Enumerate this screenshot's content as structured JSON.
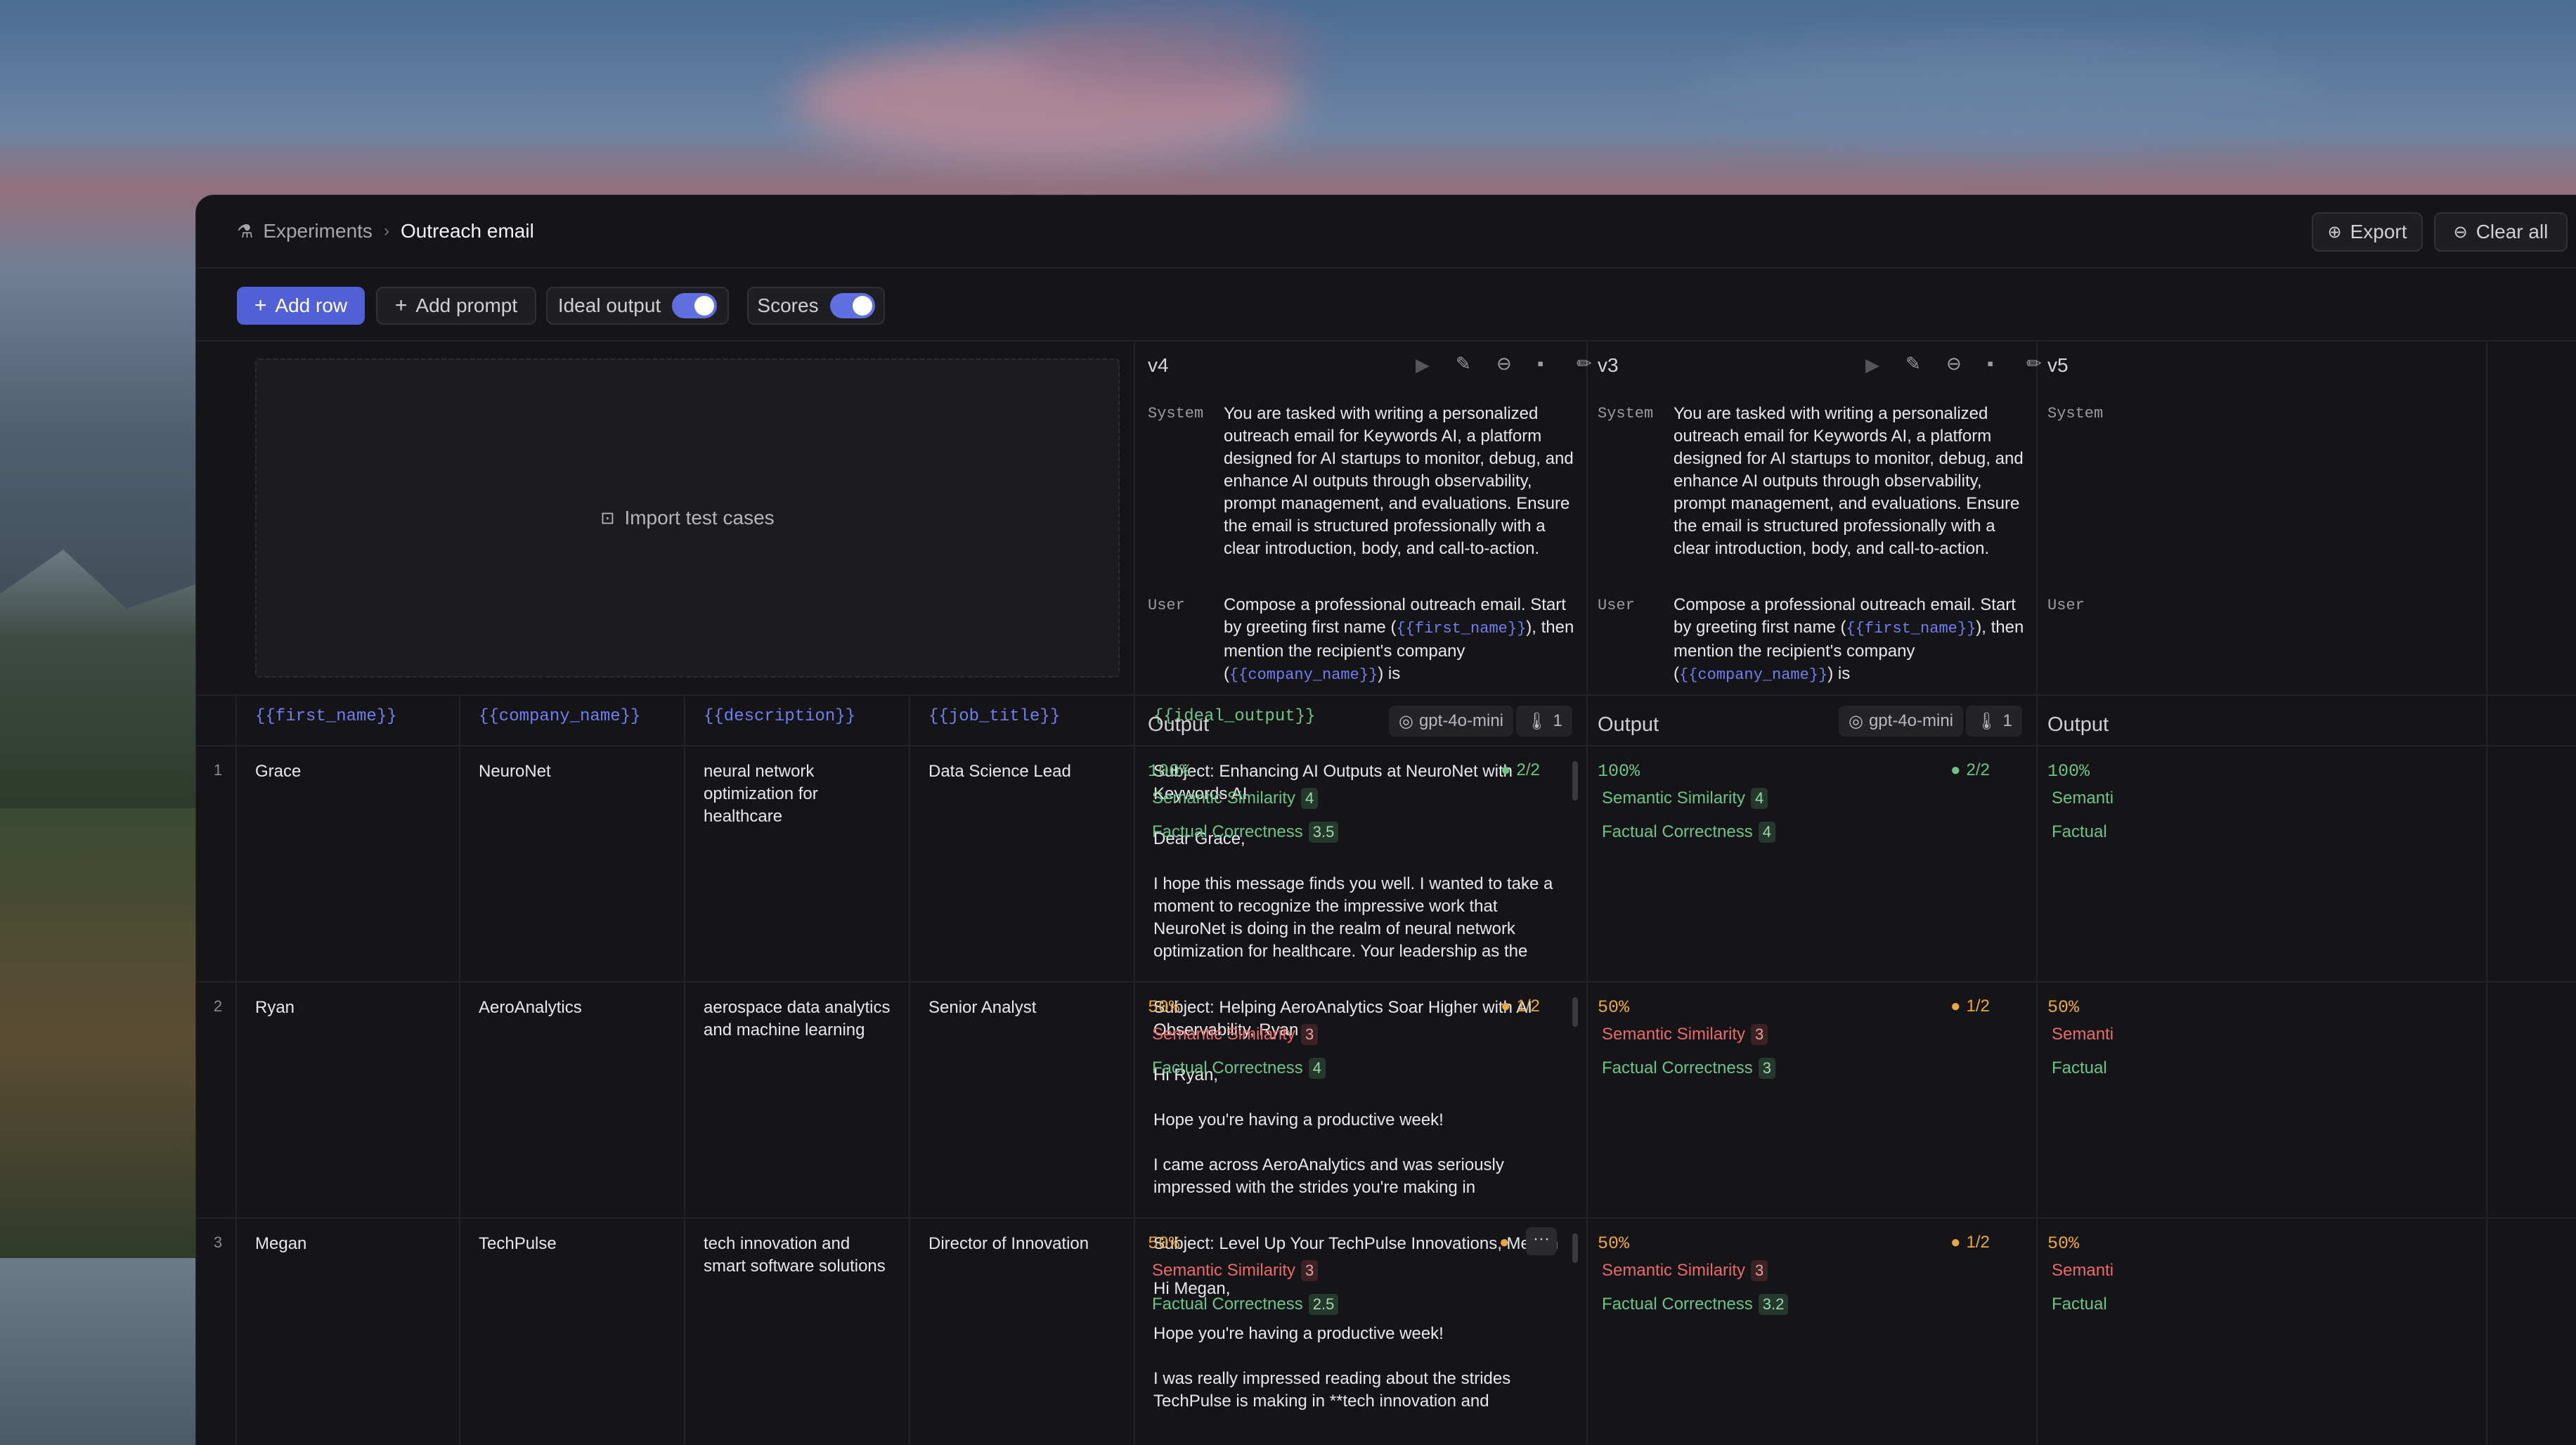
{
  "breadcrumb": {
    "parent": "Experiments",
    "current": "Outreach email"
  },
  "header": {
    "export": "Export",
    "clear_all": "Clear all"
  },
  "toolbar": {
    "add_row": "Add row",
    "add_prompt": "Add prompt",
    "ideal_output": "Ideal output",
    "scores": "Scores",
    "ideal_output_on": true,
    "scores_on": true
  },
  "import": {
    "label": "Import test cases"
  },
  "columns": [
    "{{first_name}}",
    "{{company_name}}",
    "{{description}}",
    "{{job_title}}",
    "{{ideal_output}}"
  ],
  "rows": [
    {
      "num": "1",
      "first_name": "Grace",
      "company": "NeuroNet",
      "description": "neural network optimization for healthcare",
      "job_title": "Data Science Lead",
      "ideal_output": "Subject: Enhancing AI Outputs at NeuroNet with Keywords AI\n\nDear Grace,\n\nI hope this message finds you well. I wanted to take a moment to recognize the impressive work that NeuroNet is doing in the realm of neural network optimization for healthcare. Your leadership as the Data Science Lead undoubtedly"
    },
    {
      "num": "2",
      "first_name": "Ryan",
      "company": "AeroAnalytics",
      "description": "aerospace data analytics and machine learning",
      "job_title": "Senior Analyst",
      "ideal_output": "Subject: Helping AeroAnalytics Soar Higher with AI Observability, Ryan\n\nHi Ryan,\n\nHope you're having a productive week!\n\nI came across AeroAnalytics and was seriously impressed with the strides you're making in **aerospace data analytics and machine"
    },
    {
      "num": "3",
      "first_name": "Megan",
      "company": "TechPulse",
      "description": "tech innovation and smart software solutions",
      "job_title": "Director of Innovation",
      "ideal_output": "Subject: Level Up Your TechPulse Innovations, Megan\n\nHi Megan,\n\nHope you're having a productive week!\n\nI was really impressed reading about the strides TechPulse is making in **tech innovation and"
    }
  ],
  "prompts": [
    {
      "version": "v4",
      "model": "gpt-4o-mini",
      "count": "1",
      "output_label": "Output",
      "system_label": "System",
      "system_text": "You are tasked with writing a personalized outreach email for Keywords AI, a platform designed for AI startups to monitor, debug, and enhance AI outputs through observability, prompt management, and evaluations. Ensure the email is structured professionally with a clear introduction, body, and call-to-action.",
      "user_label": "User",
      "user_a": "Compose a professional outreach email. Start by greeting first name (",
      "user_v1": "{{first_name}}",
      "user_b": "), then mention the recipient's company (",
      "user_v2": "{{company_name}}",
      "user_c": ") is",
      "results": [
        {
          "pct": "100%",
          "score": "2/2",
          "metrics": [
            {
              "name": "Semantic Similarity",
              "value": "4",
              "pass": true
            },
            {
              "name": "Factual Correctness",
              "value": "3.5",
              "pass": true
            }
          ]
        },
        {
          "pct": "50%",
          "score": "1/2",
          "metrics": [
            {
              "name": "Semantic Similarity",
              "value": "3",
              "pass": false
            },
            {
              "name": "Factual Correctness",
              "value": "4",
              "pass": true
            }
          ]
        },
        {
          "pct": "50%",
          "score": "",
          "menu": "···",
          "metrics": [
            {
              "name": "Semantic Similarity",
              "value": "3",
              "pass": false
            },
            {
              "name": "Factual Correctness",
              "value": "2.5",
              "pass": true
            }
          ]
        }
      ]
    },
    {
      "version": "v3",
      "model": "gpt-4o-mini",
      "count": "1",
      "output_label": "Output",
      "system_label": "System",
      "system_text": "You are tasked with writing a personalized outreach email for Keywords AI, a platform designed for AI startups to monitor, debug, and enhance AI outputs through observability, prompt management, and evaluations. Ensure the email is structured professionally with a clear introduction, body, and call-to-action.",
      "user_label": "User",
      "user_a": "Compose a professional outreach email. Start by greeting first name (",
      "user_v1": "{{first_name}}",
      "user_b": "), then mention the recipient's company (",
      "user_v2": "{{company_name}}",
      "user_c": ") is",
      "results": [
        {
          "pct": "100%",
          "score": "2/2",
          "metrics": [
            {
              "name": "Semantic Similarity",
              "value": "4",
              "pass": true
            },
            {
              "name": "Factual Correctness",
              "value": "4",
              "pass": true
            }
          ]
        },
        {
          "pct": "50%",
          "score": "1/2",
          "metrics": [
            {
              "name": "Semantic Similarity",
              "value": "3",
              "pass": false
            },
            {
              "name": "Factual Correctness",
              "value": "3",
              "pass": true
            }
          ]
        },
        {
          "pct": "50%",
          "score": "1/2",
          "metrics": [
            {
              "name": "Semantic Similarity",
              "value": "3",
              "pass": false
            },
            {
              "name": "Factual Correctness",
              "value": "3.2",
              "pass": true
            }
          ]
        }
      ]
    },
    {
      "version": "v5",
      "output_label": "Output",
      "system_label": "System",
      "user_label": "User",
      "results": [
        {
          "pct": "100%",
          "m1": "Semanti",
          "m2": "Factual"
        },
        {
          "pct": "50%",
          "m1": "Semanti",
          "m2": "Factual"
        },
        {
          "pct": "50%",
          "m1": "Semanti",
          "m2": "Factual"
        }
      ]
    }
  ],
  "colors": {
    "accent": "#5f6fe0",
    "pass": "#6cc389",
    "fail": "#e86a6a",
    "partial": "#e9a83f",
    "arrow": "#e5393f"
  }
}
